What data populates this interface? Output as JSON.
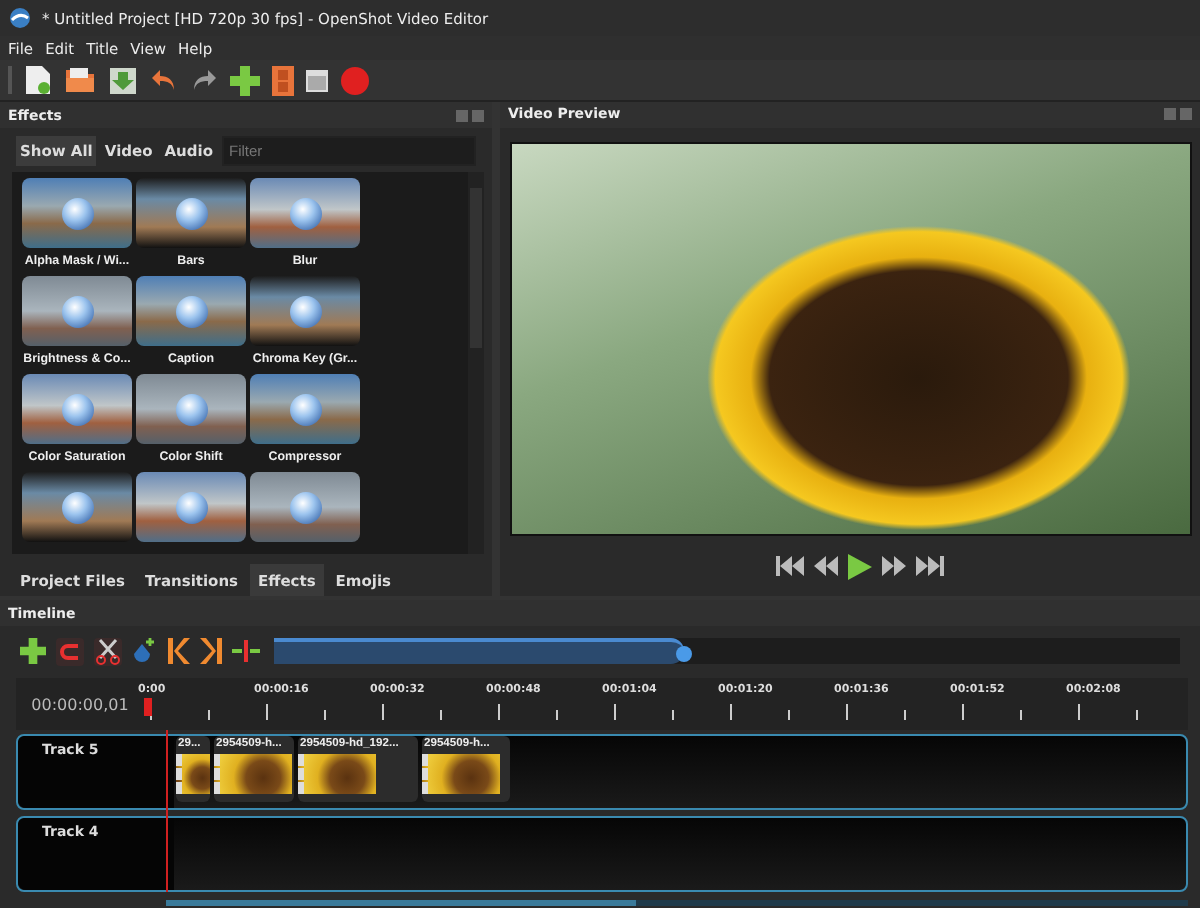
{
  "window": {
    "title": "* Untitled Project [HD 720p 30 fps] - OpenShot Video Editor"
  },
  "menu": [
    {
      "label": "File"
    },
    {
      "label": "Edit"
    },
    {
      "label": "Title"
    },
    {
      "label": "View"
    },
    {
      "label": "Help"
    }
  ],
  "effects_panel": {
    "title": "Effects",
    "filter_tabs": [
      {
        "label": "Show All",
        "selected": true
      },
      {
        "label": "Video",
        "selected": false
      },
      {
        "label": "Audio",
        "selected": false
      }
    ],
    "filter": {
      "placeholder": "Filter"
    },
    "effects": [
      {
        "kind": "labeled",
        "label": "Alpha Mask / Wi..."
      },
      {
        "kind": "labeled",
        "label": "Bars"
      },
      {
        "kind": "labeled",
        "label": "Blur"
      },
      {
        "kind": "labeled",
        "label": "Brightness & Co..."
      },
      {
        "kind": "labeled",
        "label": "Caption"
      },
      {
        "kind": "labeled",
        "label": "Chroma Key (Gr..."
      },
      {
        "kind": "labeled",
        "label": "Color Saturation"
      },
      {
        "kind": "labeled",
        "label": "Color Shift"
      },
      {
        "kind": "labeled",
        "label": "Compressor"
      },
      {
        "kind": "thumbnail"
      },
      {
        "kind": "thumbnail"
      },
      {
        "kind": "thumbnail"
      }
    ]
  },
  "bottom_tabs": [
    {
      "label": "Project Files",
      "selected": false
    },
    {
      "label": "Transitions",
      "selected": false
    },
    {
      "label": "Effects",
      "selected": true
    },
    {
      "label": "Emojis",
      "selected": false
    }
  ],
  "preview": {
    "title": "Video Preview"
  },
  "timeline": {
    "title": "Timeline",
    "timecode": "00:00:00,01",
    "ruler": [
      "0:00",
      "00:00:16",
      "00:00:32",
      "00:00:48",
      "00:01:04",
      "00:01:20",
      "00:01:36",
      "00:01:52",
      "00:02:08"
    ],
    "tracks": [
      {
        "name": "Track 5",
        "clips": [
          {
            "label": "29..."
          },
          {
            "label": "2954509-h..."
          },
          {
            "label": "2954509-hd_192..."
          },
          {
            "label": "2954509-h..."
          }
        ]
      },
      {
        "name": "Track 4"
      }
    ]
  }
}
